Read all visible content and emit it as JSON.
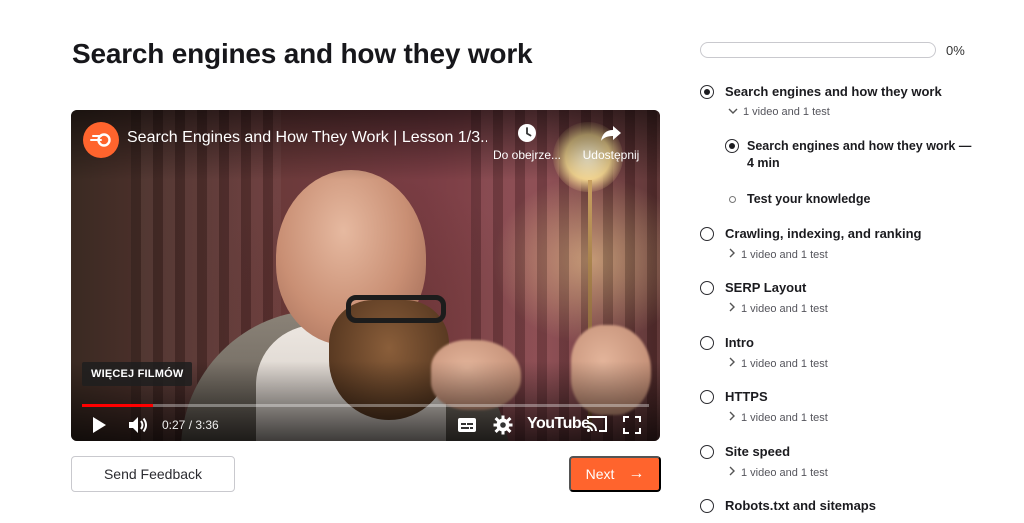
{
  "page": {
    "title": "Search engines and how they work"
  },
  "player": {
    "video_title": "Search Engines and How They Work | Lesson 1/3...",
    "watch_later_label": "Do obejrze...",
    "share_label": "Udostępnij",
    "more_videos_label": "WIĘCEJ FILMÓW",
    "time_display": "0:27 / 3:36",
    "progress_fraction": 0.125,
    "youtube_logo": "YouTube",
    "icons": [
      "semrush-channel-icon",
      "clock-icon",
      "share-icon",
      "play-icon",
      "volume-icon",
      "subtitles-icon",
      "settings-gear-icon",
      "cast-icon",
      "fullscreen-icon"
    ]
  },
  "actions": {
    "feedback_label": "Send Feedback",
    "next_label": "Next",
    "next_arrow": "→"
  },
  "course": {
    "progress_label": "0%",
    "progress_fraction": 0,
    "lessons": [
      {
        "title": "Search engines and how they work",
        "meta": "1 video and 1 test",
        "expanded": true,
        "selected": true,
        "items": [
          {
            "title": "Search engines and how they work — 4 min",
            "selected": true
          },
          {
            "title": "Test your knowledge",
            "selected": false
          }
        ]
      },
      {
        "title": "Crawling, indexing, and ranking",
        "meta": "1 video and 1 test"
      },
      {
        "title": "SERP Layout",
        "meta": "1 video and 1 test"
      },
      {
        "title": "Intro",
        "meta": "1 video and 1 test"
      },
      {
        "title": "HTTPS",
        "meta": "1 video and 1 test"
      },
      {
        "title": "Site speed",
        "meta": "1 video and 1 test"
      },
      {
        "title": "Robots.txt and sitemaps",
        "meta": ""
      }
    ]
  },
  "colors": {
    "accent": "#ff642d",
    "progress_red": "#ff0000",
    "text_dark": "#1b1b1f"
  }
}
